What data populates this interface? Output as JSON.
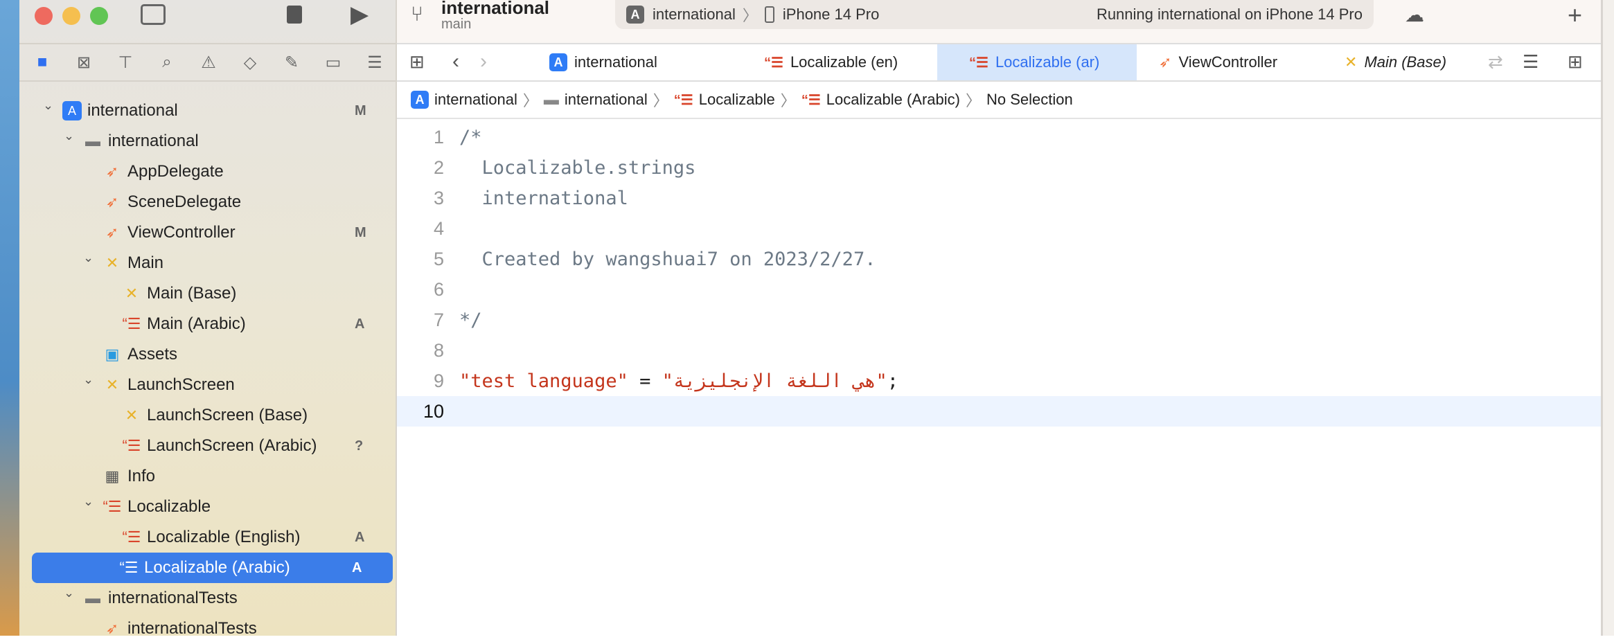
{
  "window": {
    "branch": "international",
    "branch_sub": "main",
    "scheme": "international",
    "device": "iPhone 14 Pro",
    "status": "Running international on iPhone 14 Pro"
  },
  "tabs": [
    {
      "label": "international",
      "icon": "app-icon"
    },
    {
      "label": "Localizable (en)",
      "icon": "strings-icon"
    },
    {
      "label": "Localizable (ar)",
      "icon": "strings-icon",
      "active": true
    },
    {
      "label": "ViewController",
      "icon": "swift-icon"
    },
    {
      "label": "Main (Base)",
      "icon": "storyboard-icon"
    }
  ],
  "breadcrumb": [
    "international",
    "international",
    "Localizable",
    "Localizable (Arabic)",
    "No Selection"
  ],
  "tree": [
    {
      "label": "international",
      "level": 0,
      "icon": "app",
      "chev": true,
      "badge": "M"
    },
    {
      "label": "international",
      "level": 1,
      "icon": "folder",
      "chev": true
    },
    {
      "label": "AppDelegate",
      "level": 2,
      "icon": "swift"
    },
    {
      "label": "SceneDelegate",
      "level": 2,
      "icon": "swift"
    },
    {
      "label": "ViewController",
      "level": 2,
      "icon": "swift",
      "badge": "M"
    },
    {
      "label": "Main",
      "level": 2,
      "icon": "storyboard",
      "chev": true
    },
    {
      "label": "Main (Base)",
      "level": 3,
      "icon": "storyboard"
    },
    {
      "label": "Main (Arabic)",
      "level": 3,
      "icon": "strings",
      "badge": "A"
    },
    {
      "label": "Assets",
      "level": 2,
      "icon": "assets"
    },
    {
      "label": "LaunchScreen",
      "level": 2,
      "icon": "storyboard",
      "chev": true
    },
    {
      "label": "LaunchScreen (Base)",
      "level": 3,
      "icon": "storyboard"
    },
    {
      "label": "LaunchScreen (Arabic)",
      "level": 3,
      "icon": "strings",
      "badge": "?"
    },
    {
      "label": "Info",
      "level": 2,
      "icon": "plist"
    },
    {
      "label": "Localizable",
      "level": 2,
      "icon": "strings",
      "chev": true
    },
    {
      "label": "Localizable (English)",
      "level": 3,
      "icon": "strings",
      "badge": "A"
    },
    {
      "label": "Localizable (Arabic)",
      "level": 3,
      "icon": "strings",
      "badge": "A",
      "selected": true
    },
    {
      "label": "internationalTests",
      "level": 1,
      "icon": "folder",
      "chev": true
    },
    {
      "label": "internationalTests",
      "level": 2,
      "icon": "swift"
    }
  ],
  "code": [
    {
      "n": "1",
      "parts": [
        [
          "cm",
          "/*"
        ]
      ]
    },
    {
      "n": "2",
      "parts": [
        [
          "cm",
          "  Localizable.strings"
        ]
      ]
    },
    {
      "n": "3",
      "parts": [
        [
          "cm",
          "  international"
        ]
      ]
    },
    {
      "n": "4",
      "parts": []
    },
    {
      "n": "5",
      "parts": [
        [
          "cm",
          "  Created by wangshuai7 on 2023/2/27."
        ]
      ]
    },
    {
      "n": "6",
      "parts": []
    },
    {
      "n": "7",
      "parts": [
        [
          "cm",
          "*/"
        ]
      ]
    },
    {
      "n": "8",
      "parts": []
    },
    {
      "n": "9",
      "parts": [
        [
          "str",
          "\"test language\""
        ],
        [
          "pl",
          " = "
        ],
        [
          "str",
          "\"هي اللغة الإنجليزية\""
        ],
        [
          "pl",
          ";"
        ]
      ]
    },
    {
      "n": "10",
      "parts": [],
      "current": true
    }
  ],
  "colors": {
    "accent": "#3b7de9",
    "string": "#c4351c",
    "comment": "#6c7986"
  }
}
